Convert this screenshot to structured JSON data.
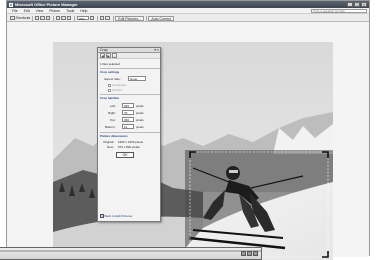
{
  "window": {
    "title": "Microsoft Office Picture Manager",
    "controls": [
      "_",
      "□",
      "×"
    ]
  },
  "menu": {
    "items": [
      "File",
      "Edit",
      "View",
      "Picture",
      "Tools",
      "Help"
    ],
    "help_placeholder": "Type a question for help"
  },
  "toolbar": {
    "shortcuts_label": "Shortcuts",
    "zoom_value": "39%",
    "edit_pictures_label": "Edit Pictures...",
    "auto_correct_label": "Auto Correct"
  },
  "dialog": {
    "title": "Crop",
    "files_selected": "1 files selected",
    "crop_settings_heading": "Crop settings",
    "aspect_ratio_label": "Aspect ratio:",
    "aspect_ratio_value": "None",
    "landscape_label": "Landscape",
    "portrait_label": "Portrait",
    "crop_handles_heading": "Crop handles",
    "left_label": "Left:",
    "left_value": "945",
    "right_label": "Right:",
    "right_value": "79",
    "top_label": "Top:",
    "top_value": "366",
    "bottom_label": "Bottom:",
    "bottom_value": "14",
    "unit": "pixels",
    "dimensions_heading": "Picture dimensions",
    "original_label": "Original:",
    "original_value": "1600 x 1200 pixels",
    "new_label": "New:",
    "new_value": "576 x 820 pixels",
    "ok_label": "OK",
    "back_link": "Back to Edit Pictures"
  },
  "icons": [
    "app-icon",
    "shortcuts-icon",
    "zoom-icon",
    "edit-pictures-icon",
    "auto-correct-icon",
    "back-icon"
  ],
  "colors": {
    "titlebar": "#4a5260",
    "dialog_heading": "#1d3e7a",
    "crop_handle": "#111111"
  }
}
